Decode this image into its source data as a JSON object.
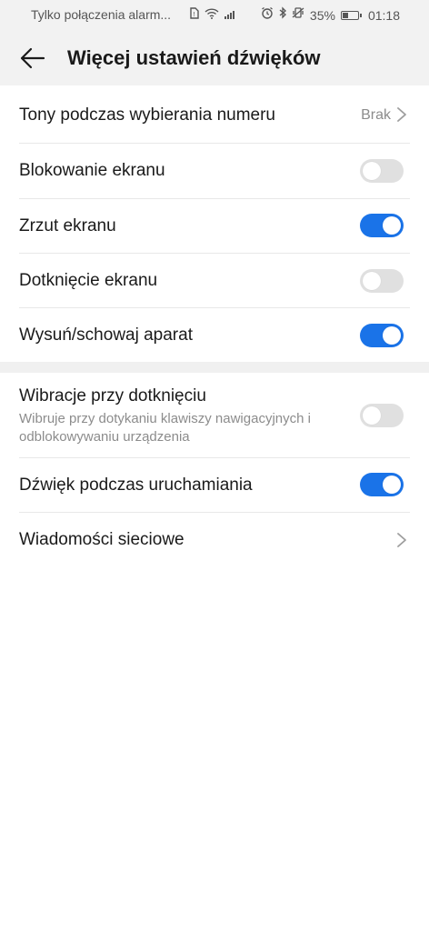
{
  "status_bar": {
    "carrier_text": "Tylko połączenia alarm...",
    "battery_percent": "35%",
    "battery_level": 0.35,
    "time": "01:18"
  },
  "header": {
    "title": "Więcej ustawień dźwięków"
  },
  "rows": {
    "dial_tones": {
      "title": "Tony podczas wybierania numeru",
      "value": "Brak"
    },
    "screen_lock": {
      "title": "Blokowanie ekranu",
      "enabled": false
    },
    "screenshot": {
      "title": "Zrzut ekranu",
      "enabled": true
    },
    "touch": {
      "title": "Dotknięcie ekranu",
      "enabled": false
    },
    "camera": {
      "title": "Wysuń/schowaj aparat",
      "enabled": true
    },
    "vibration": {
      "title": "Wibracje przy dotknięciu",
      "subtitle": "Wibruje przy dotykaniu klawiszy nawigacyjnych i odblokowywaniu urządzenia",
      "enabled": false
    },
    "startup_sound": {
      "title": "Dźwięk podczas uruchamiania",
      "enabled": true
    },
    "network_messages": {
      "title": "Wiadomości sieciowe"
    }
  },
  "colors": {
    "accent": "#1a73e8",
    "toggle_off": "#e0e0e0"
  }
}
